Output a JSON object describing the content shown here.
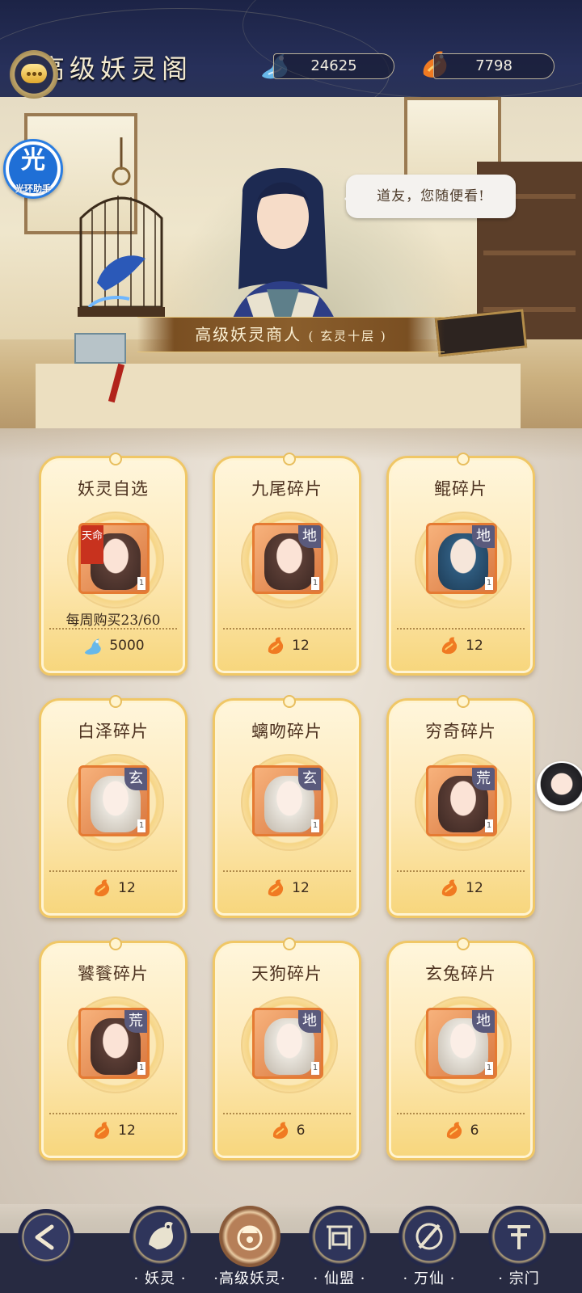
{
  "header": {
    "title": "高级妖灵阁",
    "currency1": {
      "value": "24625",
      "icon": "blue-spirit-icon",
      "color": "#7ec7f0"
    },
    "currency2": {
      "value": "7798",
      "icon": "fire-fox-icon",
      "color": "#f08a2a"
    }
  },
  "helper": {
    "glyph": "光",
    "label": "光环助手"
  },
  "scene": {
    "speech": "道友，您随便看!",
    "merchant_name": "高级妖灵商人",
    "merchant_level": "( 玄灵十层 )"
  },
  "shop": {
    "items": [
      {
        "name": "妖灵自选",
        "tag": "天命",
        "tier": "",
        "qty": "1",
        "limit": "每周购买23/60",
        "price": "5000",
        "currency": "blue-spirit-icon"
      },
      {
        "name": "九尾碎片",
        "tag": "",
        "tier": "地",
        "qty": "1",
        "limit": "",
        "price": "12",
        "currency": "fire-fox-icon"
      },
      {
        "name": "鲲碎片",
        "tag": "",
        "tier": "地",
        "qty": "1",
        "limit": "",
        "price": "12",
        "currency": "fire-fox-icon"
      },
      {
        "name": "白泽碎片",
        "tag": "",
        "tier": "玄",
        "qty": "1",
        "limit": "",
        "price": "12",
        "currency": "fire-fox-icon"
      },
      {
        "name": "螭吻碎片",
        "tag": "",
        "tier": "玄",
        "qty": "1",
        "limit": "",
        "price": "12",
        "currency": "fire-fox-icon"
      },
      {
        "name": "穷奇碎片",
        "tag": "",
        "tier": "荒",
        "qty": "1",
        "limit": "",
        "price": "12",
        "currency": "fire-fox-icon"
      },
      {
        "name": "饕餮碎片",
        "tag": "",
        "tier": "荒",
        "qty": "1",
        "limit": "",
        "price": "12",
        "currency": "fire-fox-icon"
      },
      {
        "name": "天狗碎片",
        "tag": "",
        "tier": "地",
        "qty": "1",
        "limit": "",
        "price": "6",
        "currency": "fire-fox-icon"
      },
      {
        "name": "玄兔碎片",
        "tag": "",
        "tier": "地",
        "qty": "1",
        "limit": "",
        "price": "6",
        "currency": "fire-fox-icon"
      }
    ]
  },
  "nav": {
    "back_icon": "back-arrow-icon",
    "tabs": [
      {
        "label": "· 妖灵 ·",
        "icon": "fox-spirit-icon"
      },
      {
        "label": "·高级妖灵·",
        "icon": "fox-coin-icon"
      },
      {
        "label": "· 仙盟 ·",
        "icon": "gate-icon"
      },
      {
        "label": "· 万仙 ·",
        "icon": "sword-icon"
      },
      {
        "label": "· 宗门",
        "icon": "sect-icon"
      }
    ]
  }
}
